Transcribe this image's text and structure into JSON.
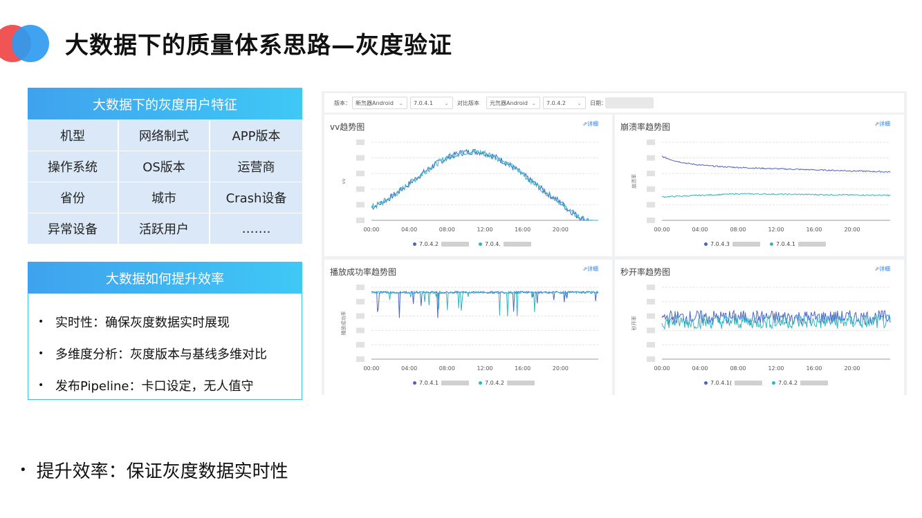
{
  "title": "大数据下的质量体系思路—灰度验证",
  "colors": {
    "accent_blue": "#3fa2ee",
    "accent_cyan": "#3fc8f6",
    "logo_red": "#f04b4b",
    "series_blue": "#4a63c9",
    "series_teal": "#2fb6c1"
  },
  "features": {
    "heading": "大数据下的灰度用户特征",
    "cells": [
      "机型",
      "网络制式",
      "APP版本",
      "操作系统",
      "OS版本",
      "运营商",
      "省份",
      "城市",
      "Crash设备",
      "异常设备",
      "活跃用户",
      "……."
    ]
  },
  "efficiency": {
    "heading": "大数据如何提升效率",
    "items": [
      "实时性：确保灰度数据实时展现",
      "多维度分析：灰度版本与基线多维对比",
      "发布Pipeline：卡口设定，无人值守"
    ]
  },
  "dashboard": {
    "filter": {
      "version_label": "版本：",
      "version_app": "新氘器Android",
      "version_num": "7.0.4.1",
      "compare_label": "对比版本",
      "compare_app": "元氘器Android",
      "compare_num": "7.0.4.2",
      "date_label": "日期："
    },
    "detail_label": "⇗详细",
    "cards": [
      {
        "title": "vv趋势图",
        "ylabel": "vv",
        "legend": [
          "7.0.4.2",
          "7.0.4."
        ]
      },
      {
        "title": "崩溃率趋势图",
        "ylabel": "崩溃率",
        "legend": [
          "7.0.4.3",
          "7.0.4.1"
        ]
      },
      {
        "title": "播放成功率趋势图",
        "ylabel": "播放成功率",
        "legend": [
          "7.0.4.1",
          "7.0.4.2"
        ]
      },
      {
        "title": "秒开率趋势图",
        "ylabel": "秒开率",
        "legend": [
          "7.0.4.1(",
          "7.0.4.2"
        ]
      }
    ],
    "x_ticks": [
      "00:00",
      "04:00",
      "08:00",
      "12:00",
      "16:00",
      "20:00"
    ]
  },
  "bottom_note": "提升效率：保证灰度数据实时性"
}
